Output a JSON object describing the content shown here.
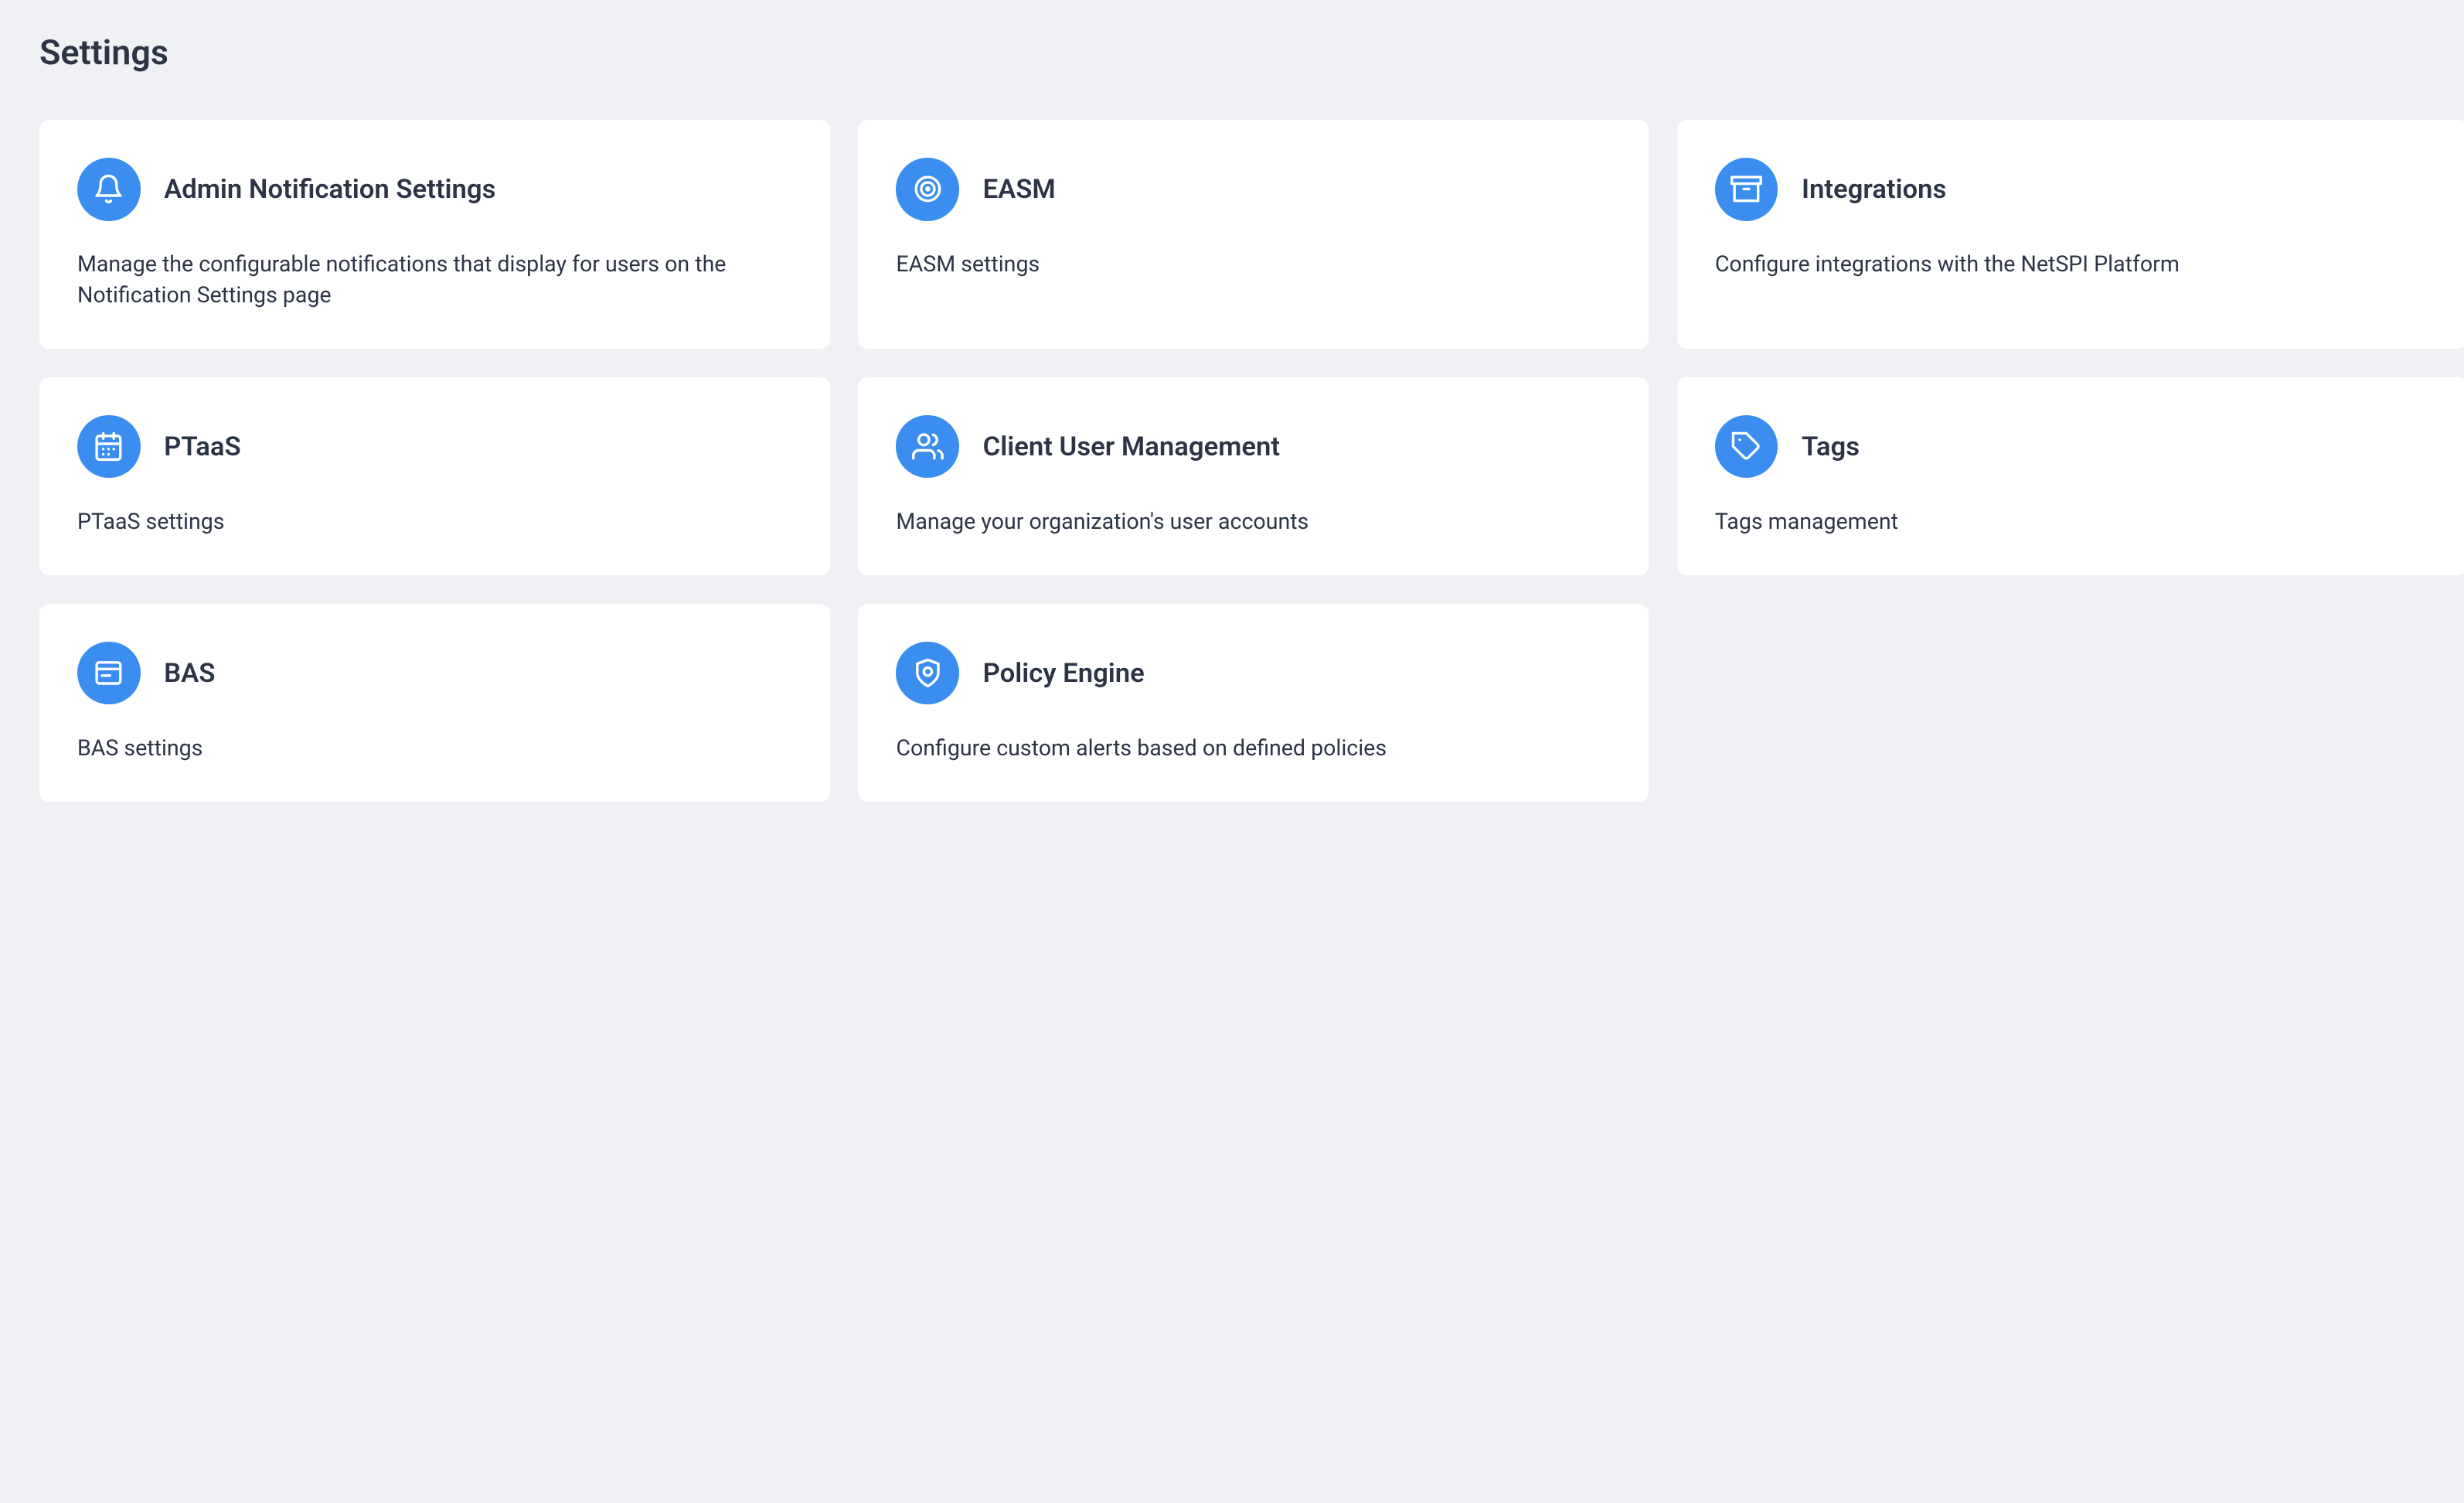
{
  "page": {
    "title": "Settings"
  },
  "cards": [
    {
      "title": "Admin Notification Settings",
      "description": "Manage the configurable notifications that display for users on the Notification Settings page"
    },
    {
      "title": "EASM",
      "description": "EASM settings"
    },
    {
      "title": "Integrations",
      "description": "Configure integrations with the NetSPI Platform"
    },
    {
      "title": "PTaaS",
      "description": "PTaaS settings"
    },
    {
      "title": "Client User Management",
      "description": "Manage your organization's user accounts"
    },
    {
      "title": "Tags",
      "description": "Tags management"
    },
    {
      "title": "BAS",
      "description": "BAS settings"
    },
    {
      "title": "Policy Engine",
      "description": "Configure custom alerts based on defined policies"
    }
  ]
}
